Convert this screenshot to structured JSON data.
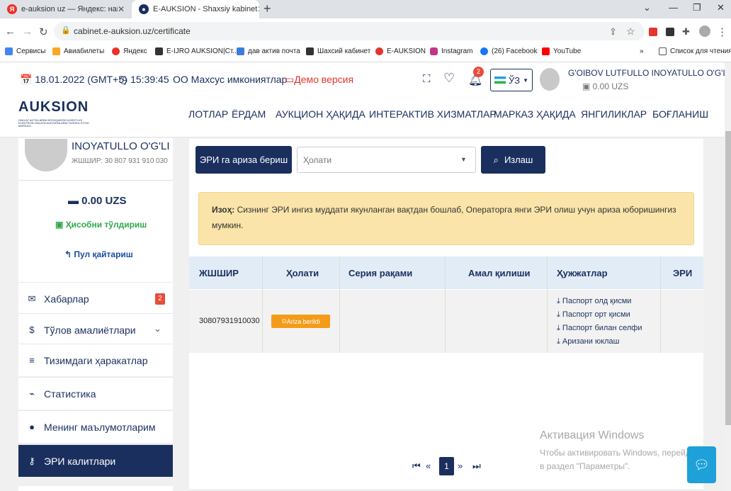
{
  "browser": {
    "tabs": [
      {
        "title": "e-auksion uz — Яндекс: нашлось",
        "favicon": "yandex-icon"
      },
      {
        "title": "E-AUKSION - Shaxsiy kabinet",
        "favicon": "e-auksion-icon"
      }
    ],
    "url": "cabinet.e-auksion.uz/certificate",
    "bookmarks": [
      "Сервисы",
      "Авиабилеты",
      "Яндекс",
      "E-IJRO AUKSION|Ст...",
      "дав актив почта",
      "Шахсий кабинет",
      "E-AUKSION",
      "Instagram",
      "(26) Facebook",
      "YouTube"
    ],
    "reading_list": "Список для чтения"
  },
  "header": {
    "date": "18.01.2022 (GMT+5)",
    "time": "15:39:45",
    "accessibility": "Махсус имкониятлар",
    "demo": "Демо версия",
    "notifications": "2",
    "language": "ЎЗ",
    "user_name": "G'OIBOV LUTFULLO INOYATULLO O'G'LI",
    "user_balance": "0.00 UZS"
  },
  "nav": {
    "logo": "AUKSION",
    "logo_sub": "DAVLAT AKTIVLARINI BOSHQARISH AGENTLIGI ELEKTRON ONLAYN AUKSIONLARNI TASHKIL ETISH MARKAZI",
    "items": [
      "ЛОТЛАР",
      "ЁРДАМ",
      "АУКЦИОН ҲАҚИДА",
      "ИНТЕРАКТИВ ХИЗМАТЛАР",
      "МАРКАЗ ҲАҚИДА",
      "ЯНГИЛИКЛАР",
      "БОҒЛАНИШ"
    ]
  },
  "sidebar": {
    "name": "INOYATULLO O'G'LI",
    "jshshir": "ЖШШИР: 30 807 931 910 030",
    "balance": "0.00 UZS",
    "topup": "Ҳисобни тўлдириш",
    "refund": "Пул қайтариш",
    "menu": [
      {
        "label": "Хабарлар",
        "icon": "envelope-icon",
        "badge": "2"
      },
      {
        "label": "Тўлов амалиётлари",
        "icon": "payment-icon"
      },
      {
        "label": "Тизимдаги ҳаракатлар",
        "icon": "list-icon"
      },
      {
        "label": "Статистика",
        "icon": "chart-icon"
      },
      {
        "label": "Менинг маълумотларим",
        "icon": "user-icon"
      },
      {
        "label": "ЭРИ калитлари",
        "icon": "key-icon"
      }
    ]
  },
  "main": {
    "apply_button": "ЭРИ га ариза бериш",
    "status_placeholder": "Ҳолати",
    "search_button": "Излаш",
    "note_label": "Изоҳ:",
    "note_text": "Сизнинг ЭРИ ингиз муддати якунланган вақтдан бошлаб, Операторга янги ЭРИ олиш учун ариза юборишингиз мумкин.",
    "columns": [
      "ЖШШИР",
      "Ҳолати",
      "Серия рақами",
      "Амал қилиши",
      "Ҳужжатлар",
      "ЭРИ"
    ],
    "row": {
      "jshshir": "30807931910030",
      "status": "Ariza berildi",
      "documents": [
        "Паспорт олд қисми",
        "Паспорт орт қисми",
        "Паспорт билан селфи",
        "Аризани юклаш"
      ]
    },
    "page": "1"
  },
  "watermark": {
    "title": "Активация Windows",
    "text": "Чтобы активировать Windows, перейдите в раздел \"Параметры\"."
  },
  "colors": {
    "primary": "#1a2f5e",
    "accent": "#f59b1a",
    "note": "#fbe4a9",
    "danger": "#e74c3c"
  }
}
